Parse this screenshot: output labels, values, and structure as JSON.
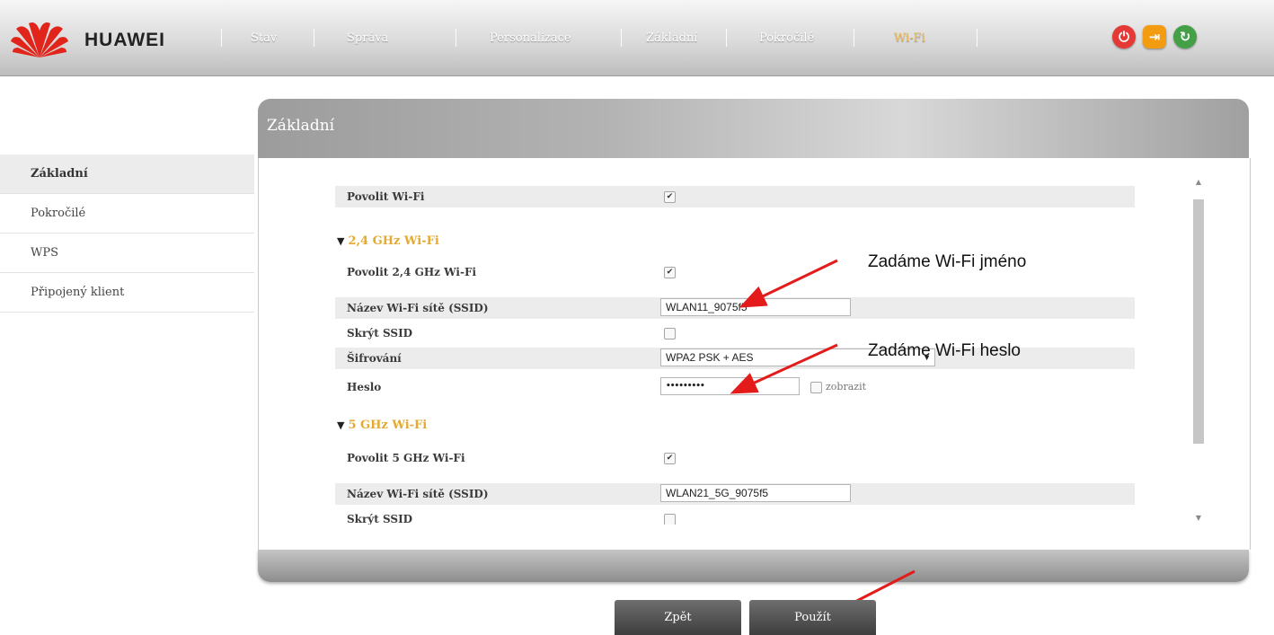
{
  "header": {
    "brand": "HUAWEI",
    "nav": [
      {
        "label": "Stav",
        "active": false
      },
      {
        "label": "Správa",
        "active": false
      },
      {
        "label": "Personalizace",
        "active": false
      },
      {
        "label": "Základní",
        "active": false
      },
      {
        "label": "Pokročilé",
        "active": false
      },
      {
        "label": "Wi-Fi",
        "active": true
      }
    ],
    "icons": [
      {
        "name": "power-icon",
        "color": "#e53935"
      },
      {
        "name": "logout-icon",
        "color": "#f39c12"
      },
      {
        "name": "refresh-icon",
        "color": "#43a047"
      }
    ]
  },
  "sidebar": {
    "items": [
      {
        "label": "Základní",
        "active": true
      },
      {
        "label": "Pokročilé",
        "active": false
      },
      {
        "label": "WPS",
        "active": false
      },
      {
        "label": "Připojený klient",
        "active": false
      }
    ]
  },
  "panel": {
    "title": "Základní",
    "enable_wifi": {
      "label": "Povolit Wi-Fi",
      "checked": true
    },
    "band24": {
      "title": "2,4 GHz Wi-Fi",
      "enable": {
        "label": "Povolit 2,4 GHz Wi-Fi",
        "checked": true
      },
      "ssid": {
        "label": "Název Wi-Fi sítě (SSID)",
        "value": "WLAN11_9075f5"
      },
      "hide_ssid": {
        "label": "Skrýt SSID",
        "checked": false
      },
      "encryption": {
        "label": "Šifrování",
        "value": "WPA2 PSK + AES"
      },
      "password": {
        "label": "Heslo",
        "value": "•••••••••",
        "show_label": "zobrazit",
        "show_checked": false
      }
    },
    "band5": {
      "title": "5 GHz Wi-Fi",
      "enable": {
        "label": "Povolit 5 GHz Wi-Fi",
        "checked": true
      },
      "ssid": {
        "label": "Název Wi-Fi sítě (SSID)",
        "value": "WLAN21_5G_9075f5"
      },
      "hide_ssid": {
        "label": "Skrýt SSID",
        "checked": false
      }
    }
  },
  "buttons": {
    "back": "Zpět",
    "apply": "Použít"
  },
  "annotations": {
    "ssid_note": "Zadáme Wi-Fi jméno",
    "password_note": "Zadáme Wi-Fi heslo"
  },
  "colors": {
    "accent": "#e4a92f",
    "arrow": "#e41b1b"
  }
}
